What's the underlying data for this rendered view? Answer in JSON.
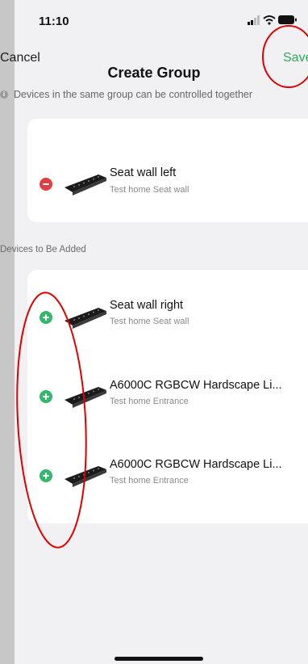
{
  "status_bar": {
    "time": "11:10"
  },
  "nav": {
    "cancel_label": "Cancel",
    "save_label": "Save",
    "title": "Create Group"
  },
  "hint": {
    "icon": "info-icon",
    "text": "Devices in the same group can be controlled together"
  },
  "group_devices": [
    {
      "name": "Seat wall left",
      "subtitle": "Test home Seat wall",
      "action": "remove"
    }
  ],
  "section_label": "Devices to Be Added",
  "devices_to_add": [
    {
      "name": "Seat wall right",
      "subtitle": "Test home Seat wall",
      "action": "add"
    },
    {
      "name": "A6000C RGBCW Hardscape Li...",
      "subtitle": "Test home Entrance",
      "action": "add"
    },
    {
      "name": "A6000C RGBCW Hardscape Li...",
      "subtitle": "Test home Entrance",
      "action": "add"
    }
  ],
  "colors": {
    "accent_green": "#2ea95d",
    "remove_red": "#e23e43",
    "add_green": "#35b66d",
    "annotation_red": "#e00000"
  }
}
